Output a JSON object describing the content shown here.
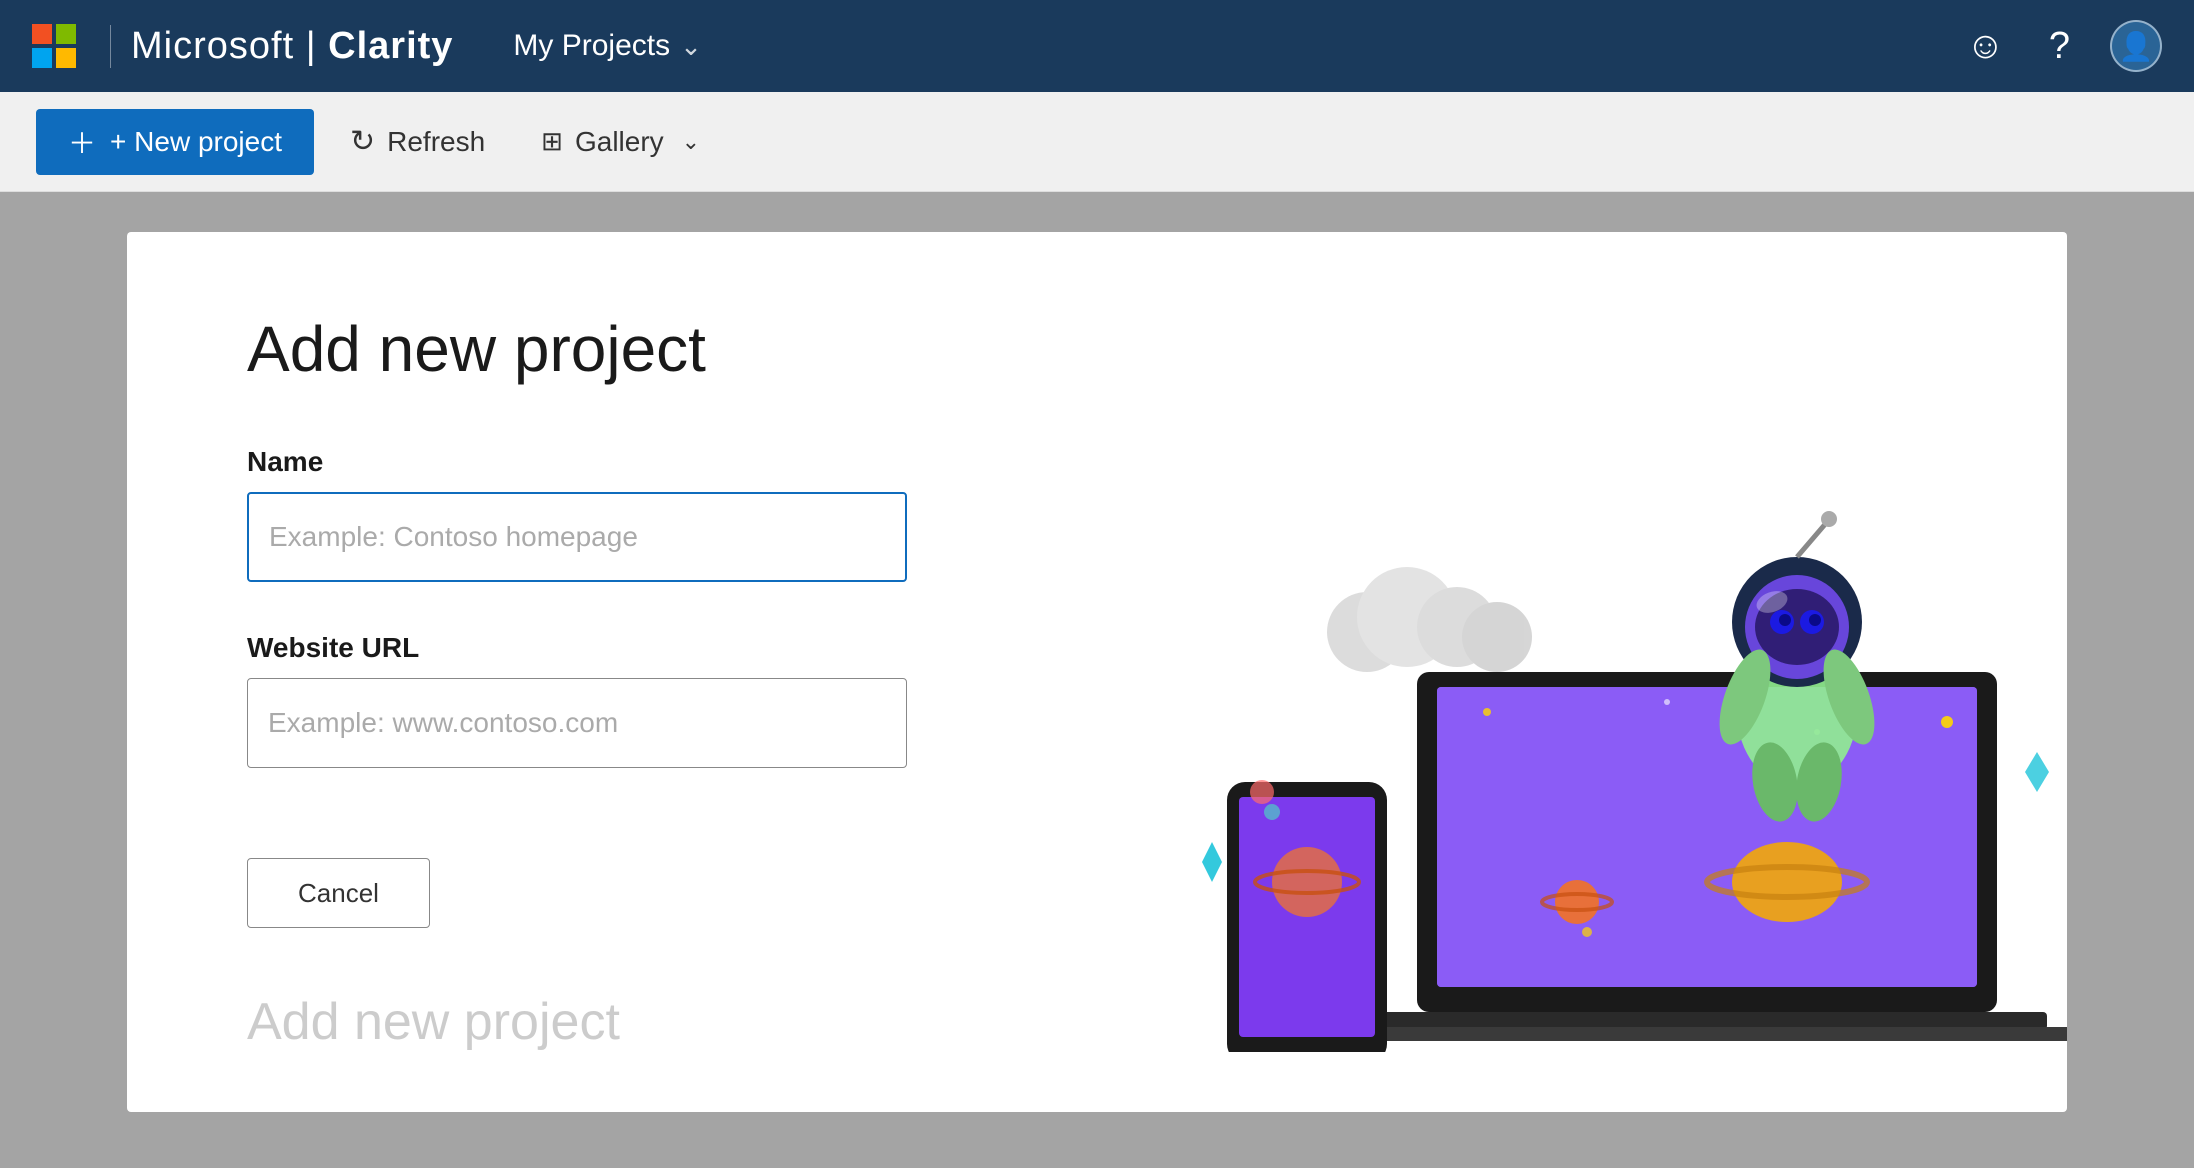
{
  "app": {
    "brand": "Microsoft",
    "separator": "|",
    "product": "Clarity"
  },
  "nav": {
    "projects_label": "My Projects",
    "smile_icon": "☺",
    "help_icon": "?",
    "avatar_icon": "👤"
  },
  "toolbar": {
    "new_project_label": "+ New project",
    "refresh_label": "Refresh",
    "gallery_label": "Gallery"
  },
  "dialog": {
    "title": "Add new project",
    "name_label": "Name",
    "name_placeholder": "Example: Contoso homepage",
    "url_label": "Website URL",
    "url_placeholder": "Example: www.contoso.com",
    "cancel_label": "Cancel",
    "add_label": "Add new project",
    "bottom_hint": "Add new project"
  },
  "colors": {
    "nav_bg": "#1a3a5c",
    "toolbar_bg": "#f0f0f0",
    "accent": "#0f6cbd",
    "dialog_bg": "#ffffff"
  }
}
